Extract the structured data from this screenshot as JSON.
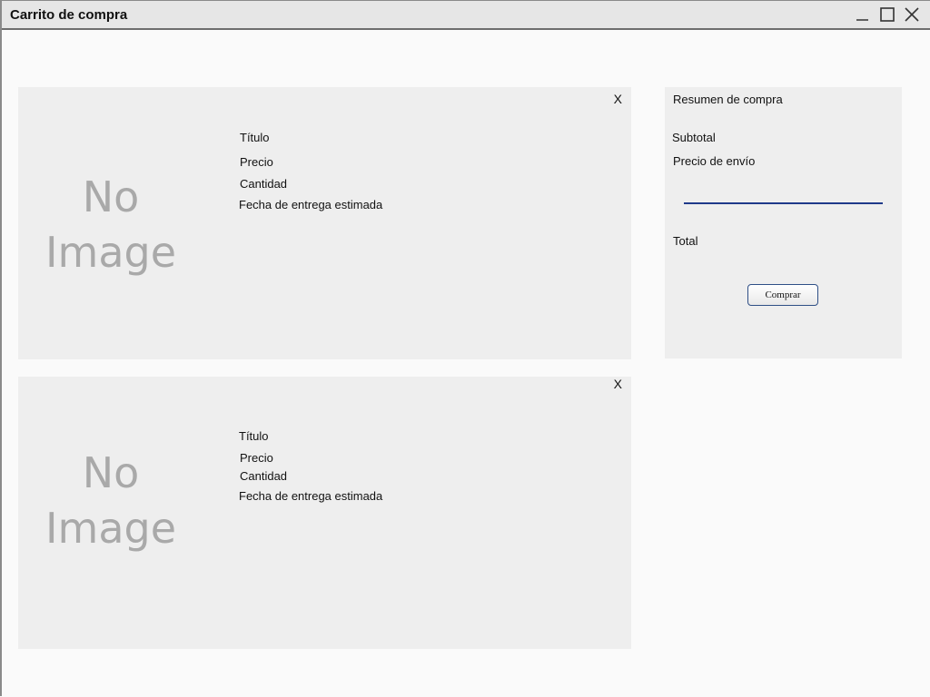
{
  "window": {
    "title": "Carrito de compra",
    "controls": {
      "minimize_icon": "minimize-icon",
      "maximize_icon": "maximize-icon",
      "close_icon": "close-icon"
    }
  },
  "products": [
    {
      "image_text_line1": "No",
      "image_text_line2": "Image",
      "remove_label": "X",
      "title_label": "Título",
      "price_label": "Precio",
      "quantity_label": "Cantidad",
      "delivery_label": "Fecha de entrega estimada"
    },
    {
      "image_text_line1": "No",
      "image_text_line2": "Image",
      "remove_label": "X",
      "title_label": "Título",
      "price_label": "Precio",
      "quantity_label": "Cantidad",
      "delivery_label": "Fecha de entrega estimada"
    }
  ],
  "summary": {
    "heading": "Resumen de compra",
    "subtotal_label": "Subtotal",
    "shipping_label": "Precio de envío",
    "total_label": "Total",
    "buy_button_label": "Comprar",
    "divider_color": "#1f3a8a"
  }
}
